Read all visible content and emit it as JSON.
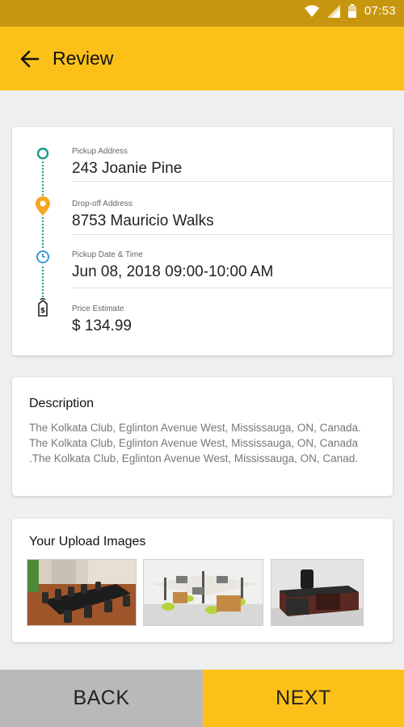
{
  "status_bar": {
    "time": "07:53",
    "icons": [
      "wifi-icon",
      "signal-icon",
      "battery-icon"
    ]
  },
  "header": {
    "title": "Review",
    "back_icon": "arrow-left-icon"
  },
  "route": {
    "pickup": {
      "label": "Pickup Address",
      "value": "243 Joanie Pine",
      "icon": "circle-outline-icon"
    },
    "dropoff": {
      "label": "Drop-off Address",
      "value": "8753 Mauricio Walks",
      "icon": "map-pin-icon"
    },
    "datetime": {
      "label": "Pickup Date & Time",
      "value": "Jun 08, 2018 09:00-10:00 AM",
      "icon": "clock-icon"
    },
    "price": {
      "label": "Price Estimate",
      "value": "$ 134.99",
      "icon": "price-tag-icon"
    }
  },
  "description": {
    "heading": "Description",
    "text": "The Kolkata Club, Eglinton Avenue West, Mississauga, ON, Canada. The Kolkata Club, Eglinton Avenue West, Mississauga, ON, Canada .The Kolkata Club, Eglinton Avenue West, Mississauga, ON, Canad."
  },
  "uploads": {
    "heading": "Your Upload Images",
    "images": [
      "conference-table-image",
      "office-workstations-image",
      "executive-desk-image"
    ]
  },
  "actions": {
    "back_label": "BACK",
    "next_label": "NEXT"
  },
  "colors": {
    "primary": "#fcc118",
    "status_bar": "#c8960e",
    "teal": "#1a9b8c",
    "orange": "#f5a623",
    "blue": "#2a8fd4",
    "back_button": "#b9b9b9"
  }
}
